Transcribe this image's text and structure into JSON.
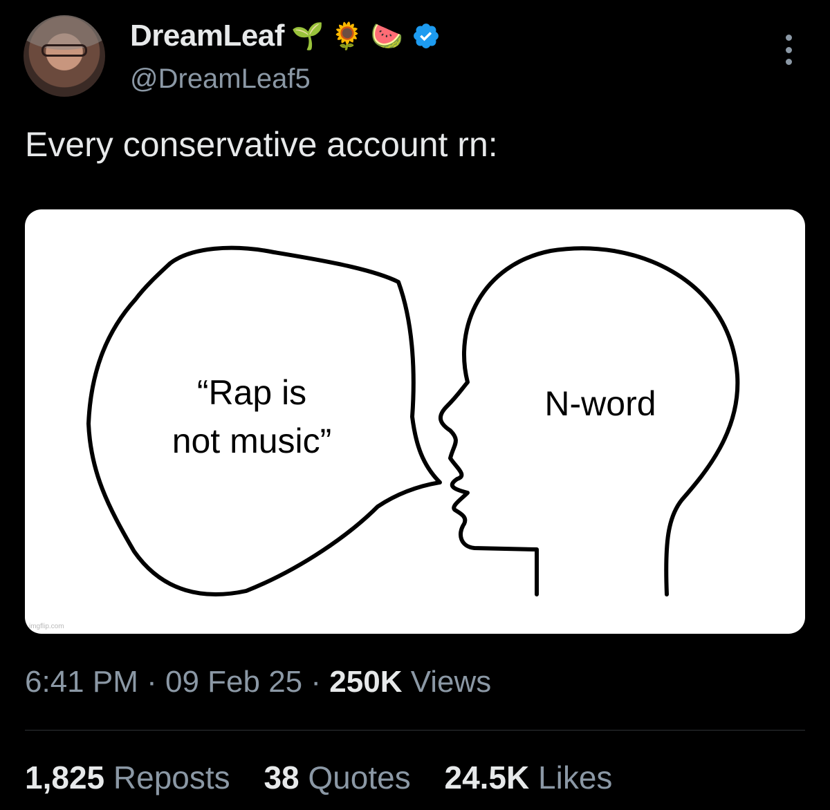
{
  "author": {
    "display_name": "DreamLeaf",
    "emojis": [
      "🌱",
      "🌻",
      "🍉"
    ],
    "handle": "@DreamLeaf5",
    "verified_color": "#1d9bf0"
  },
  "tweet": {
    "text": "Every conservative account rn:",
    "meme": {
      "bubble_text_line1": "“Rap is",
      "bubble_text_line2": "not music”",
      "head_text": "N-word",
      "watermark": "imgflip.com"
    }
  },
  "meta": {
    "time": "6:41 PM",
    "date": "09 Feb 25",
    "separator": "·",
    "views_count": "250K",
    "views_label": "Views"
  },
  "stats": {
    "reposts_count": "1,825",
    "reposts_label": "Reposts",
    "quotes_count": "38",
    "quotes_label": "Quotes",
    "likes_count": "24.5K",
    "likes_label": "Likes"
  },
  "icons": {
    "more": "more-vertical-icon",
    "verified": "verified-badge-icon"
  }
}
